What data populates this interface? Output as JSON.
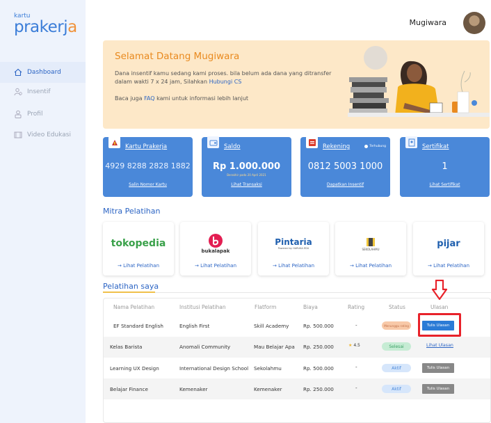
{
  "brand": {
    "logo_small": "kartu",
    "logo_big_a": "prakerj",
    "logo_big_b": "a"
  },
  "sidebar": {
    "items": [
      {
        "label": "Dashboard",
        "icon": "home-icon",
        "active": true
      },
      {
        "label": "Insentif",
        "icon": "user-coin-icon",
        "active": false
      },
      {
        "label": "Profil",
        "icon": "profile-icon",
        "active": false
      },
      {
        "label": "Video Edukasi",
        "icon": "video-icon",
        "active": false
      }
    ]
  },
  "header": {
    "username": "Mugiwara"
  },
  "banner": {
    "title": "Selamat Datang Mugiwara",
    "text_before": "Dana insentif kamu sedang kami proses. bila belum ada dana  yang ditransfer dalam wakti 7 x 24 jam, Silahkan ",
    "text_link": "Hubungi CS",
    "text2_before": "Baca juga ",
    "text2_link": "FAQ",
    "text2_after": " kami untuk informasi lebih lanjut"
  },
  "cards": [
    {
      "title": "Kartu Prakerja",
      "value": "4929 8288 2828 1882",
      "note": "",
      "link": "Salin Nomor Kartu",
      "icon": "flag-icon"
    },
    {
      "title": "Saldo",
      "value": "Rp 1.000.000",
      "note": "Berakhir pada 20 April 2021",
      "link": "Lihat Transaksi",
      "icon": "wallet-icon"
    },
    {
      "title": "Rekening",
      "value": "0812 5003 1000",
      "note": "",
      "link": "Dapatkan Insentif",
      "icon": "account-icon",
      "badge": "Terhubung"
    },
    {
      "title": "Sertifikat",
      "value": "1",
      "note": "",
      "link": "Lihat Sertifikat",
      "icon": "certificate-icon"
    }
  ],
  "mitra": {
    "title": "Mitra Pelatihan",
    "items": [
      {
        "name": "tokopedia",
        "link": "Lihat Pelatihan"
      },
      {
        "name": "bukalapak",
        "link": "Lihat Pelatihan"
      },
      {
        "name": "Pintaria",
        "sub": "Powered by HARUKA EDU",
        "link": "Lihat Pelatihan"
      },
      {
        "name": "SEKOLAHMU",
        "link": "Lihat Pelatihan"
      },
      {
        "name": "pijar",
        "link": "Lihat Pelatihan"
      }
    ]
  },
  "pelatihan": {
    "title": "Pelatihan saya",
    "headers": [
      "Nama Pelatihan",
      "Institusi Pelatihan",
      "Flatform",
      "Biaya",
      "Rating",
      "Status",
      "Ulasan"
    ],
    "rows": [
      {
        "nama": "EF Standard English",
        "institusi": "English First",
        "platform": "Skill Academy",
        "biaya": "Rp. 500.000",
        "rating": "-",
        "status": "Menunggu rating",
        "ulasan": "Tulis Ulasan",
        "status_color": "#f8c9a8",
        "status_text_color": "#c0704a",
        "ulasan_type": "primary"
      },
      {
        "nama": "Kelas Barista",
        "institusi": "Anomali Community",
        "platform": "Mau Belajar Apa",
        "biaya": "Rp. 250.000",
        "rating": "4.5",
        "status": "Selesai",
        "ulasan": "Lihat Ulasan",
        "status_color": "#c6ecd4",
        "status_text_color": "#3aa064",
        "ulasan_type": "link"
      },
      {
        "nama": "Learning UX Design",
        "institusi": "International Design School",
        "platform": "Sekolahmu",
        "biaya": "Rp. 500.000",
        "rating": "-",
        "status": "Aktif",
        "ulasan": "Tulis Ulasan",
        "status_color": "#d6e6fb",
        "status_text_color": "#4a88d9",
        "ulasan_type": "gray"
      },
      {
        "nama": "Belajar Finance",
        "institusi": "Kemenaker",
        "platform": "Kemenaker",
        "biaya": "Rp. 250.000",
        "rating": "-",
        "status": "Aktif",
        "ulasan": "Tulis Ulasan",
        "status_color": "#d6e6fb",
        "status_text_color": "#4a88d9",
        "ulasan_type": "gray"
      }
    ]
  },
  "colors": {
    "primary": "#2b64c4",
    "card_blue": "#4a88d9",
    "banner_bg": "#fde8c8",
    "accent_orange": "#e98a1f",
    "highlight_red": "#e8222a"
  }
}
